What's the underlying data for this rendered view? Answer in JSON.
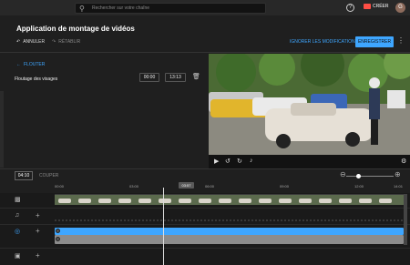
{
  "header": {
    "search_placeholder": "Rechercher sur votre chaîne",
    "create_label": "CRÉER",
    "avatar_letter": "G"
  },
  "editor": {
    "title": "Application de montage de vidéos",
    "undo_label": "ANNULER",
    "redo_label": "RÉTABLIR",
    "discard_label": "IGNORER LES MODIFICATIONS",
    "save_label": "ENREGISTRER"
  },
  "blur_panel": {
    "back_label": "FLOUTER",
    "item_label": "Floutage des visages",
    "start_time": "00:00",
    "end_time": "13:13"
  },
  "timeline": {
    "current_time": "04:10",
    "cut_label": "COUPER",
    "cursor_time": "03:57",
    "ruler_ticks": [
      "00:00",
      "03:00",
      "06:00",
      "09:00",
      "12:00",
      "14:01"
    ],
    "zoom_level": 0.2
  },
  "colors": {
    "accent": "#3ea6ff",
    "brand_red": "#ff4e45",
    "background": "#1f1f1f"
  },
  "icons": {
    "search": "search-icon",
    "help": "help-icon",
    "create": "video-camera-icon",
    "undo": "undo-icon",
    "redo": "redo-icon",
    "back": "arrow-left-icon",
    "trash": "trash-icon",
    "play": "play-icon",
    "rewind": "rewind-10-icon",
    "forward": "forward-10-icon",
    "volume": "volume-icon",
    "settings": "gear-icon",
    "zoom_out": "zoom-out-icon",
    "zoom_in": "zoom-in-icon",
    "video_track": "video-icon",
    "audio_track": "music-note-icon",
    "blur_track": "blur-icon",
    "endscreen_track": "endscreen-icon"
  }
}
